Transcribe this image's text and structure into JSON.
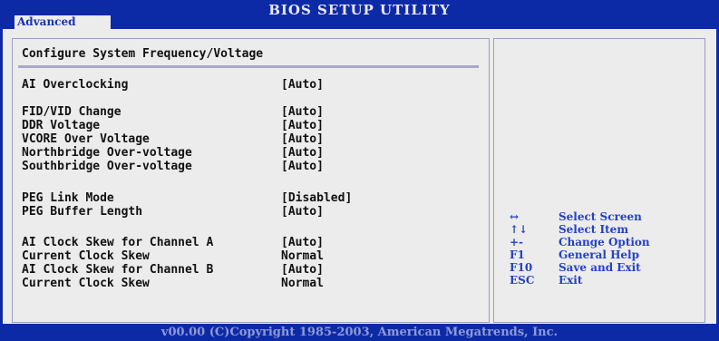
{
  "header": {
    "title": "BIOS SETUP UTILITY",
    "tab": "Advanced"
  },
  "section_title": "Configure System Frequency/Voltage",
  "settings": [
    {
      "label": "AI Overclocking",
      "value": "[Auto]"
    },
    {
      "label": "FID/VID Change",
      "value": "[Auto]"
    },
    {
      "label": "DDR Voltage",
      "value": "[Auto]"
    },
    {
      "label": "VCORE Over Voltage",
      "value": "[Auto]"
    },
    {
      "label": "Northbridge Over-voltage",
      "value": "[Auto]"
    },
    {
      "label": "Southbridge Over-voltage",
      "value": "[Auto]"
    },
    {
      "label": "PEG Link Mode",
      "value": "[Disabled]"
    },
    {
      "label": "PEG Buffer Length",
      "value": "[Auto]"
    },
    {
      "label": "AI Clock Skew for Channel A",
      "value": "[Auto]"
    },
    {
      "label": "Current Clock Skew",
      "value": "Normal"
    },
    {
      "label": "AI Clock Skew for Channel B",
      "value": "[Auto]"
    },
    {
      "label": "Current Clock Skew",
      "value": "Normal"
    }
  ],
  "help": [
    {
      "key": "↔",
      "desc": "Select Screen"
    },
    {
      "key": "↑↓",
      "desc": "Select Item"
    },
    {
      "key": "+-",
      "desc": "Change Option"
    },
    {
      "key": "F1",
      "desc": "General Help"
    },
    {
      "key": "F10",
      "desc": "Save and Exit"
    },
    {
      "key": "ESC",
      "desc": "Exit"
    }
  ],
  "footer": "v00.00 (C)Copyright 1985-2003, American Megatrends, Inc.",
  "colors": {
    "background": "#0d2aa6",
    "panel": "#ececec",
    "help_text": "#2441c8"
  }
}
